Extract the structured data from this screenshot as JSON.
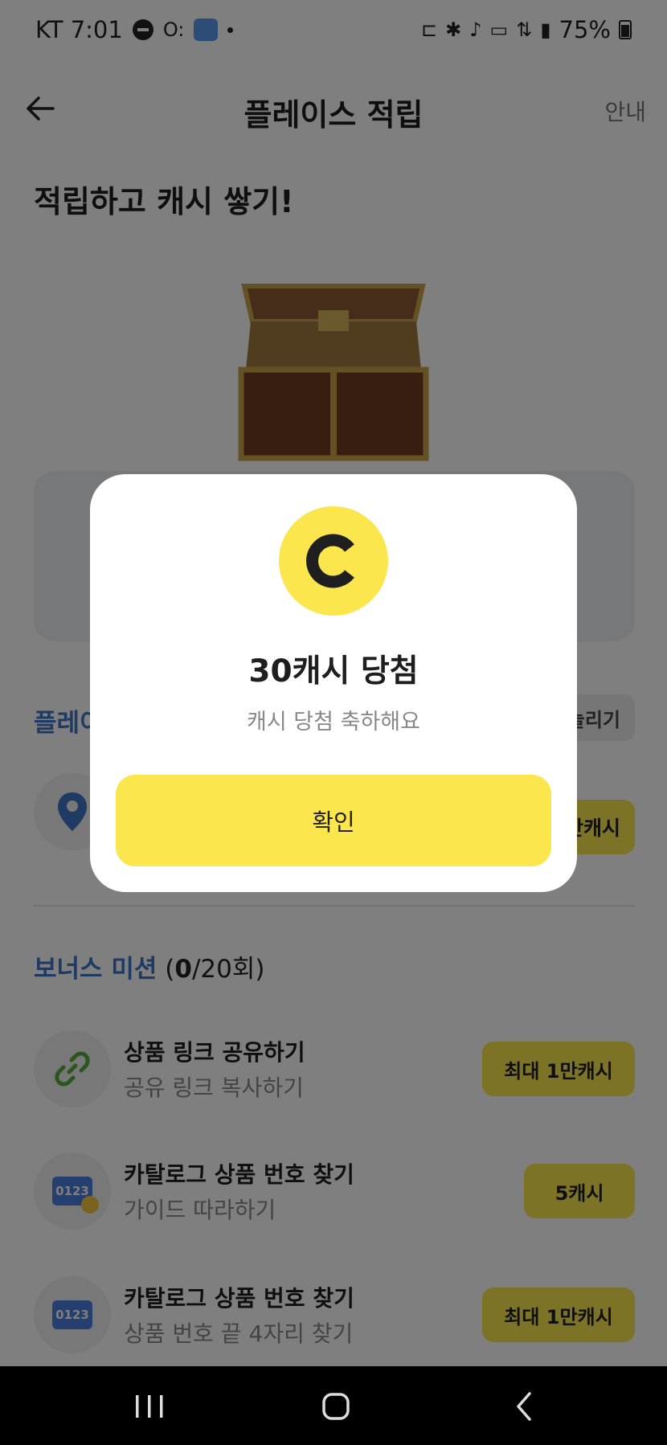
{
  "status_bar": {
    "carrier_time": "KT 7:01",
    "battery": "75%"
  },
  "header": {
    "title": "플레이스 적립",
    "guide": "안내"
  },
  "hero": {
    "title": "적립하고 캐시 쌓기!"
  },
  "place_section": {
    "title_partial": "플레이",
    "more_partial": "늘리기",
    "reward_partial": "만캐시"
  },
  "bonus": {
    "title": "보너스 미션",
    "count_open": " (",
    "count_done": "0",
    "count_rest": "/20회)",
    "missions": [
      {
        "title": "상품 링크 공유하기",
        "subtitle": "공유 링크 복사하기",
        "reward": "최대 1만캐시",
        "icon": "link-icon"
      },
      {
        "title": "카탈로그 상품 번호 찾기",
        "subtitle": "가이드 따라하기",
        "reward": "5캐시",
        "icon": "number-badge-icon",
        "badge": "0123"
      },
      {
        "title": "카탈로그 상품 번호 찾기",
        "subtitle": "상품 번호 끝 4자리 찾기",
        "reward": "최대 1만캐시",
        "icon": "number-badge-icon",
        "badge": "0123"
      }
    ]
  },
  "modal": {
    "title": "30캐시 당첨",
    "subtitle": "캐시 당첨 축하해요",
    "confirm": "확인"
  },
  "colors": {
    "accent_yellow": "#fbe64d",
    "blue": "#3f74c7"
  }
}
